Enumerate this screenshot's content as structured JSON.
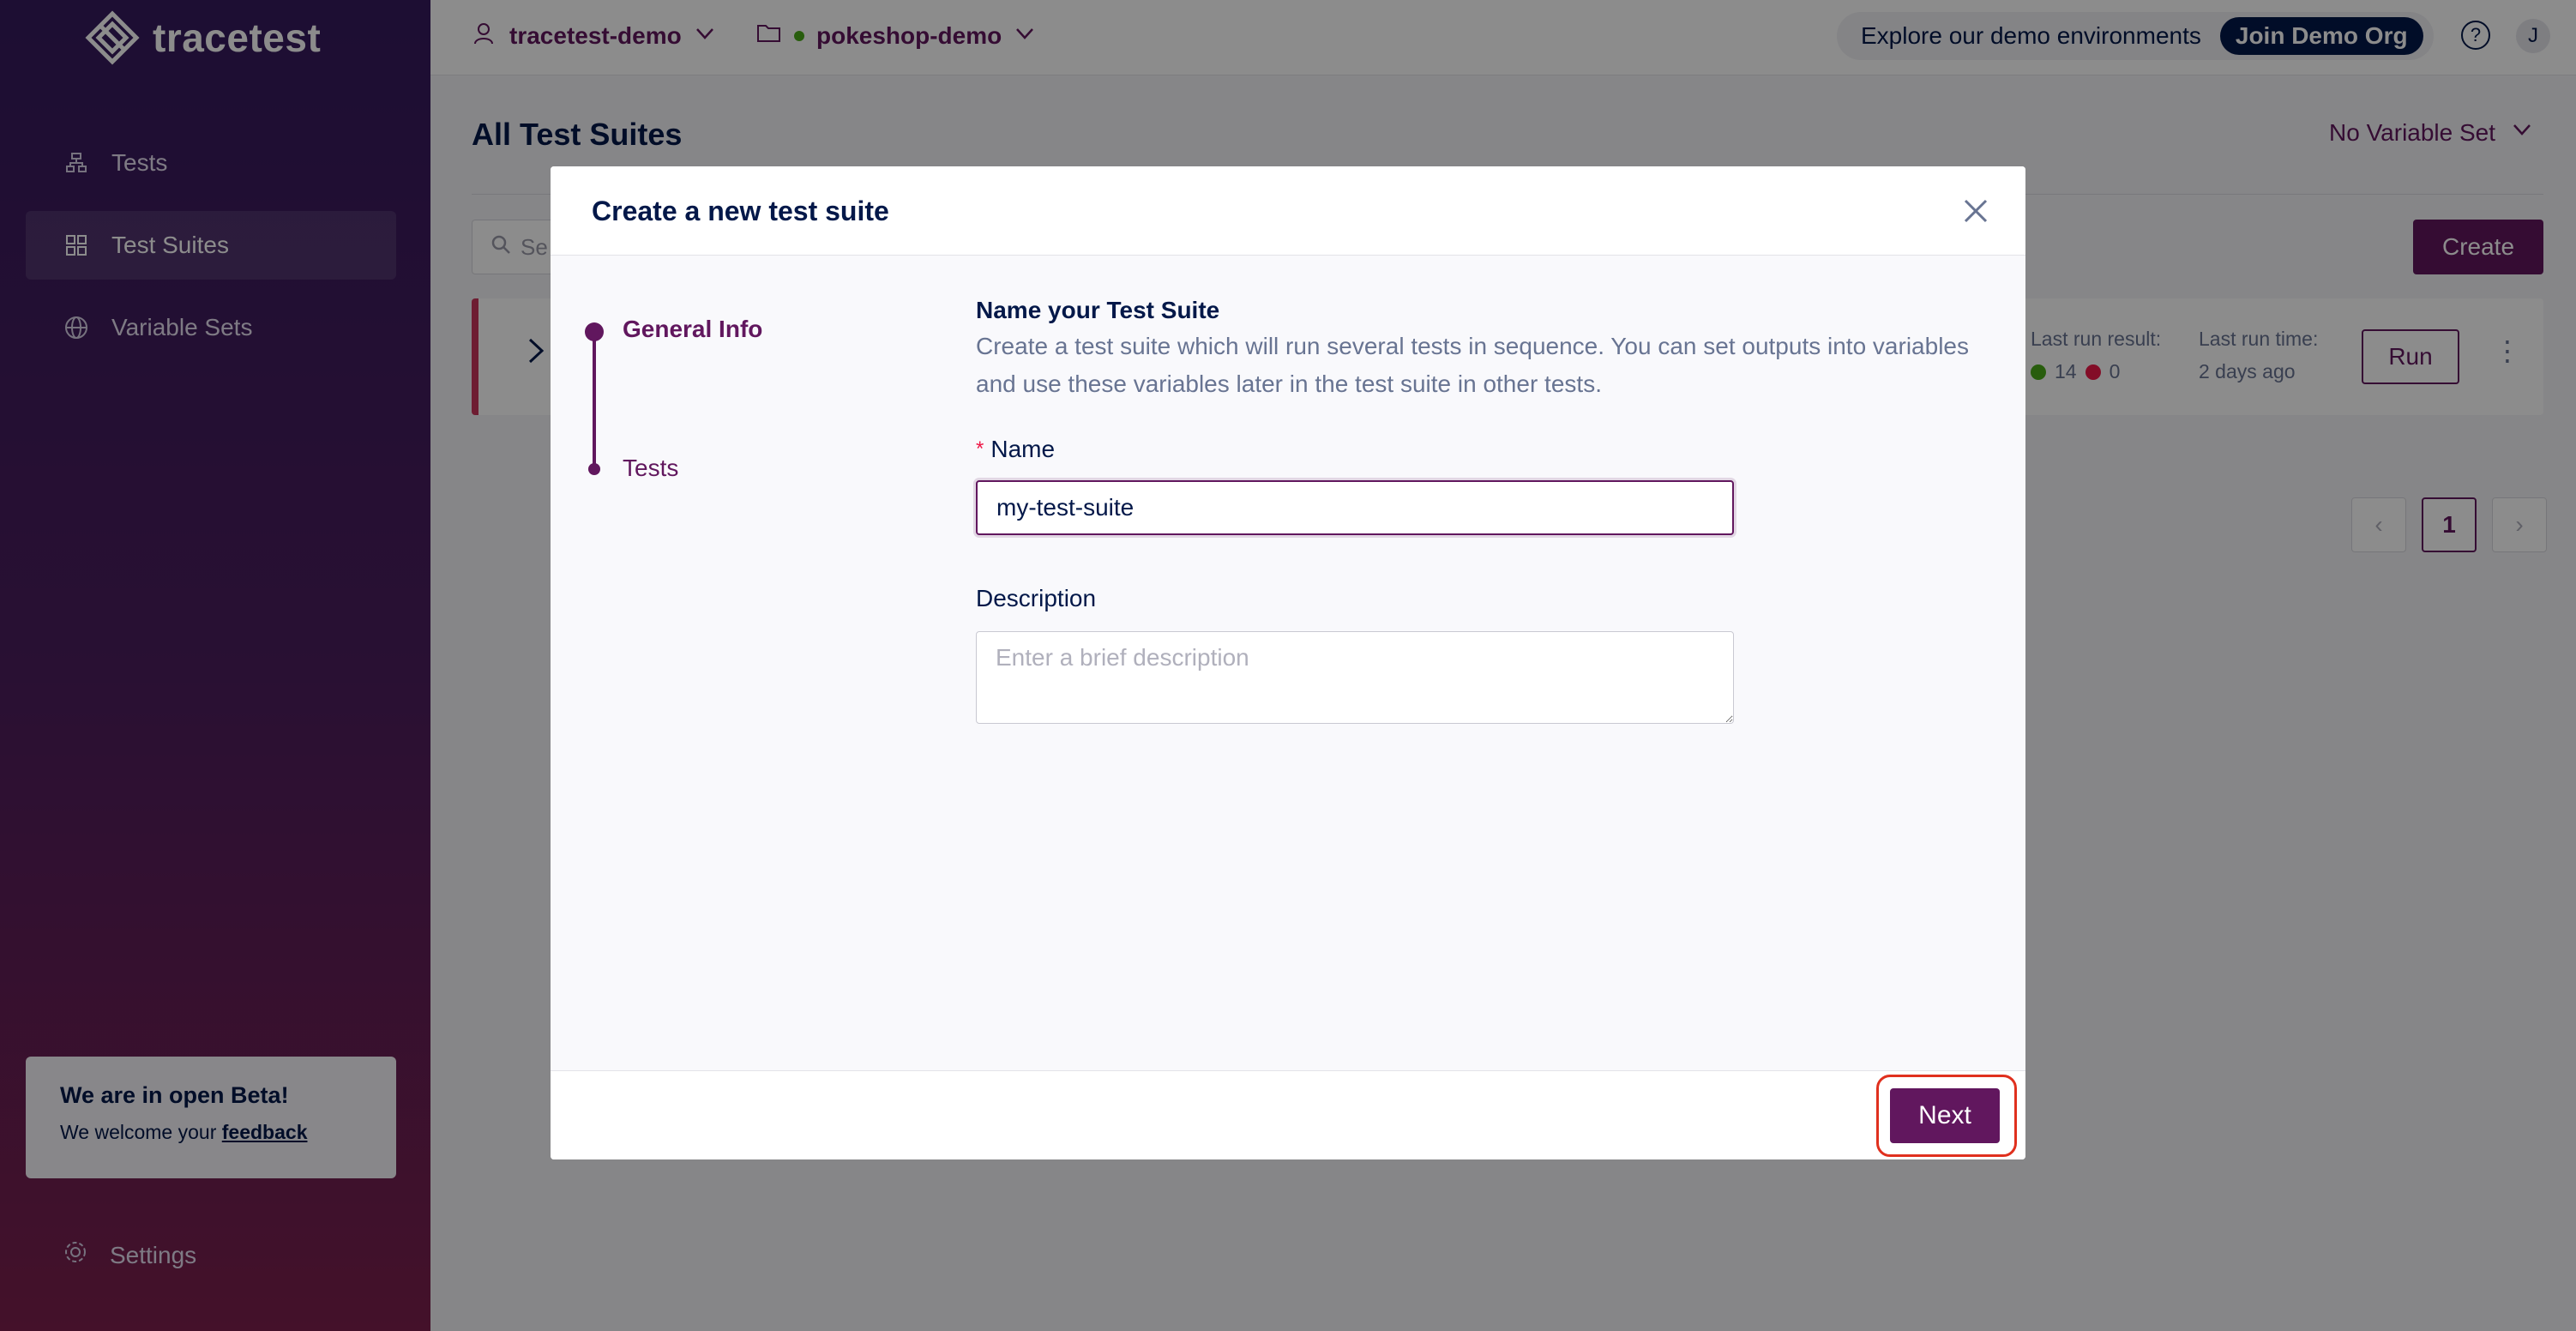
{
  "brand": {
    "name": "tracetest"
  },
  "sidebar": {
    "items": [
      {
        "label": "Tests",
        "icon": "tests-icon"
      },
      {
        "label": "Test Suites",
        "icon": "test-suites-icon",
        "active": true
      },
      {
        "label": "Variable Sets",
        "icon": "globe-icon"
      }
    ],
    "beta": {
      "title": "We are in open Beta!",
      "text": "We welcome your",
      "link": "feedback"
    },
    "settings_label": "Settings"
  },
  "header": {
    "org": "tracetest-demo",
    "environment": "pokeshop-demo",
    "explore_text": "Explore our demo environments",
    "join_label": "Join Demo Org",
    "help_icon": "?",
    "avatar_initial": "J"
  },
  "main": {
    "title": "All Test Suites",
    "variable_set": "No Variable Set",
    "search_placeholder": "Se",
    "create_label": "Create",
    "row": {
      "last_run_result_label": "Last run result:",
      "passed": "14",
      "failed": "0",
      "last_run_time_label": "Last run time:",
      "last_run_time": "2 days ago",
      "run_label": "Run"
    },
    "pagination": {
      "current": "1"
    }
  },
  "modal": {
    "title": "Create a new test suite",
    "steps": [
      {
        "label": "General Info",
        "active": true
      },
      {
        "label": "Tests",
        "active": false
      }
    ],
    "form": {
      "heading": "Name your Test Suite",
      "description": "Create a test suite which will run several tests in sequence. You can set outputs into variables and use these variables later in the test suite in other tests.",
      "name_label": "Name",
      "name_required_mark": "*",
      "name_value": "my-test-suite",
      "description_label": "Description",
      "description_placeholder": "Enter a brief description"
    },
    "next_label": "Next"
  },
  "colors": {
    "primary": "#61175e",
    "navy": "#031849",
    "success": "#49aa19",
    "error": "#ee1847",
    "highlight_ring": "#e0301e"
  }
}
